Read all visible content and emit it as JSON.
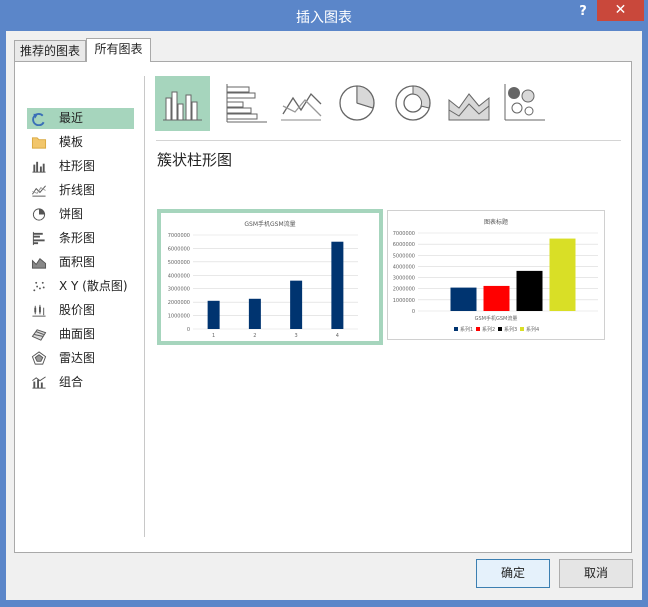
{
  "window": {
    "title": "插入图表",
    "help": "?",
    "close": "✕"
  },
  "tabs": [
    {
      "label": "推荐的图表"
    },
    {
      "label": "所有图表"
    }
  ],
  "nav": {
    "items": [
      {
        "label": "最近",
        "icon": "recent-icon"
      },
      {
        "label": "模板",
        "icon": "folder-icon"
      },
      {
        "label": "柱形图",
        "icon": "column-chart-icon"
      },
      {
        "label": "折线图",
        "icon": "line-chart-icon"
      },
      {
        "label": "饼图",
        "icon": "pie-chart-icon"
      },
      {
        "label": "条形图",
        "icon": "bar-chart-icon"
      },
      {
        "label": "面积图",
        "icon": "area-chart-icon"
      },
      {
        "label": "X Y (散点图)",
        "icon": "scatter-chart-icon"
      },
      {
        "label": "股价图",
        "icon": "stock-chart-icon"
      },
      {
        "label": "曲面图",
        "icon": "surface-chart-icon"
      },
      {
        "label": "雷达图",
        "icon": "radar-chart-icon"
      },
      {
        "label": "组合",
        "icon": "combo-chart-icon"
      }
    ]
  },
  "chart_types": [
    "clustered-column",
    "clustered-bar",
    "line",
    "pie",
    "doughnut",
    "area",
    "scatter-bubble"
  ],
  "subtype_title": "簇状柱形图",
  "chart_data": [
    {
      "type": "bar",
      "title": "GSM手机GSM流量",
      "categories": [
        "1",
        "2",
        "3",
        "4"
      ],
      "values": [
        2100000,
        2250000,
        3600000,
        6500000
      ],
      "ylim": [
        0,
        7000000
      ],
      "yticks": [
        "7000000",
        "6000000",
        "5000000",
        "4000000",
        "3000000",
        "2000000",
        "1000000",
        "0"
      ],
      "grid": true,
      "colors": [
        "#003470"
      ]
    },
    {
      "type": "bar",
      "title": "图表标题",
      "xlabel": "GSM手机GSM流量",
      "categories": [
        "GSM手机GSM流量"
      ],
      "series": [
        {
          "name": "系列1",
          "values": [
            2100000
          ],
          "color": "#003470"
        },
        {
          "name": "系列2",
          "values": [
            2250000
          ],
          "color": "#ff0000"
        },
        {
          "name": "系列3",
          "values": [
            3600000
          ],
          "color": "#000000"
        },
        {
          "name": "系列4",
          "values": [
            6500000
          ],
          "color": "#d9df26"
        }
      ],
      "ylim": [
        0,
        7000000
      ],
      "yticks": [
        "7000000",
        "6000000",
        "5000000",
        "4000000",
        "3000000",
        "2000000",
        "1000000",
        "0"
      ],
      "grid": true,
      "legend": "bottom"
    }
  ],
  "buttons": {
    "ok": "确定",
    "cancel": "取消"
  },
  "colors": {
    "accent": "#a6d5bd",
    "titlebar": "#5b86c9",
    "close": "#c9483b"
  }
}
